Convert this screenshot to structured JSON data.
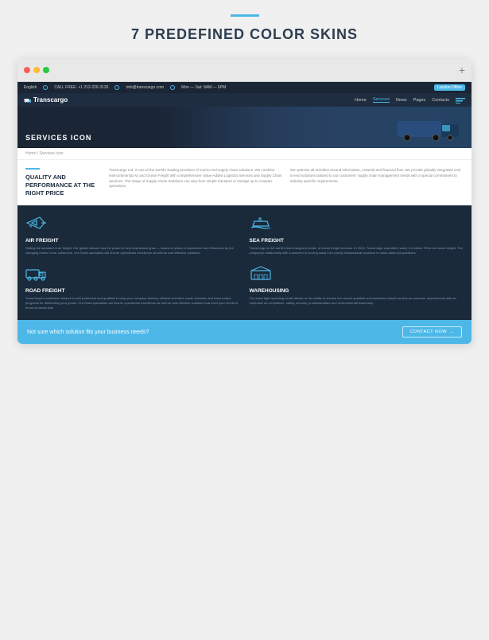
{
  "page": {
    "bg_color": "#f0f0f0"
  },
  "top": {
    "divider_color": "#4db8e8",
    "title": "7 PREDEFINED COLOR SKINS"
  },
  "browser": {
    "plus_icon": "+"
  },
  "topbar": {
    "lang": "English",
    "phone_label": "CALL FREE: +1 212-226-3126",
    "email_label": "info@transcargo.com",
    "hours_label": "Mon — Sat: 9AM — 6PM",
    "location_label": "London Office"
  },
  "navbar": {
    "logo": "Transcargo",
    "links": [
      "Home",
      "Services",
      "News",
      "Pages",
      "Contacts"
    ]
  },
  "hero": {
    "title": "SERVICES ICON"
  },
  "breadcrumb": {
    "path": "Home / Services Icon"
  },
  "quality": {
    "accent_color": "#4db8e8",
    "title": "QUALITY AND PERFORMANCE AT THE RIGHT PRICE",
    "text1": "Transcargo Ltd. is one of the world's leading providers of end-to-end supply chain solutions. We combine intercontinental Air and Ocean Freight with comprehensive Value-Added Logistics Services and Supply Chain Services. The range of Supply Chain Solutions can vary from simple transport or storage up to complex operations.",
    "text2": "We optimise all activities around information, material and financial flow. We provide globally integrated end-to-end solutions tailored to our customers' supply chain management needs with a special commitment to industry specific requirements."
  },
  "services": {
    "items": [
      {
        "id": "air",
        "title": "AIR FREIGHT",
        "text": "Setting the standard in air freight. Our global network has the power to help businesses grow — based on years of experience and influenced by the changing needs of our customers. Our Road specialists will ensure operational excellence as well as cost-effective solutions.",
        "icon": "plane"
      },
      {
        "id": "sea",
        "title": "SEA FREIGHT",
        "text": "TransCargo is the world's fourth largest provider of ocean freight services. In 2013, TransCargo expedited nearly 1.5 million TEUs via ocean freight. The company's relationship with customers is moving away from purely transactional business to value-added propositions.",
        "icon": "ship"
      },
      {
        "id": "road",
        "title": "ROAD FREIGHT",
        "text": "TransCargo's worldwide network is well positioned and qualified to help your company develop efficient and tailor-made domestic and trans-border programs for distributing your goods. Our Road specialists will ensure operational excellence as well as cost-effective solutions that meet your needs in terms of transit time.",
        "icon": "truck"
      },
      {
        "id": "warehouse",
        "title": "WAREHOUSING",
        "text": "Our asset light operating model allows us the ability to choose the correct qualified subcontractors based on diverse customer requirements with an emphasis on compliance, safety, security, professionalism and environmental leadership.",
        "icon": "warehouse"
      }
    ]
  },
  "cta": {
    "text": "Not sure which solution fits your business needs?",
    "button_label": "CONTACT NOW",
    "arrow": "→"
  }
}
